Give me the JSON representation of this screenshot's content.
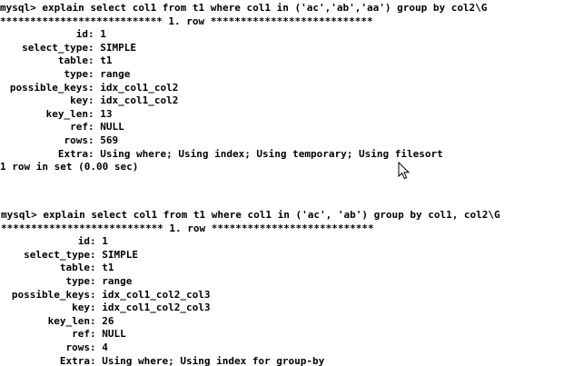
{
  "terminal": {
    "block1": {
      "command": "mysql> explain select col1 from t1 where col1 in ('ac','ab','aa') group by col2\\G",
      "row_header": "*************************** 1. row ***************************",
      "fields": [
        {
          "name": "id",
          "value": "1"
        },
        {
          "name": "select_type",
          "value": "SIMPLE"
        },
        {
          "name": "table",
          "value": "t1"
        },
        {
          "name": "type",
          "value": "range"
        },
        {
          "name": "possible_keys",
          "value": "idx_col1_col2"
        },
        {
          "name": "key",
          "value": "idx_col1_col2"
        },
        {
          "name": "key_len",
          "value": "13"
        },
        {
          "name": "ref",
          "value": "NULL"
        },
        {
          "name": "rows",
          "value": "569"
        },
        {
          "name": "Extra",
          "value": "Using where; Using index; Using temporary; Using filesort"
        }
      ],
      "summary": "1 row in set (0.00 sec)"
    },
    "block2": {
      "command": "mysql> explain select col1 from t1 where col1 in ('ac', 'ab') group by col1, col2\\G",
      "row_header": "*************************** 1. row ***************************",
      "fields": [
        {
          "name": "id",
          "value": "1"
        },
        {
          "name": "select_type",
          "value": "SIMPLE"
        },
        {
          "name": "table",
          "value": "t1"
        },
        {
          "name": "type",
          "value": "range"
        },
        {
          "name": "possible_keys",
          "value": "idx_col1_col2_col3"
        },
        {
          "name": "key",
          "value": "idx_col1_col2_col3"
        },
        {
          "name": "key_len",
          "value": "26"
        },
        {
          "name": "ref",
          "value": "NULL"
        },
        {
          "name": "rows",
          "value": "4"
        },
        {
          "name": "Extra",
          "value": "Using where; Using index for group-by"
        }
      ]
    },
    "colors": {
      "background": "#ffffff",
      "text": "#000000"
    },
    "icons": {
      "pointer": "mouse-pointer-icon"
    }
  }
}
